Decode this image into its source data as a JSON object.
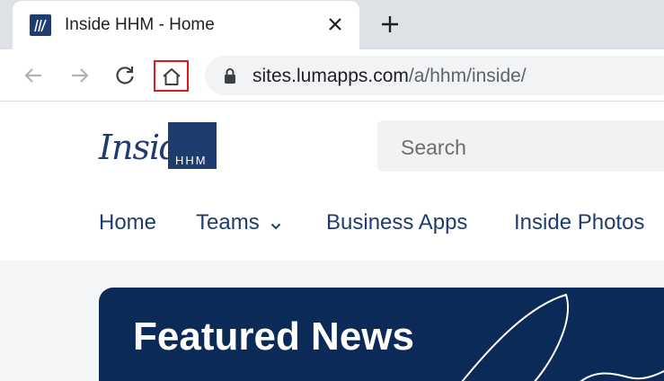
{
  "browser": {
    "tab": {
      "title": "Inside HHM - Home",
      "favicon": "site-favicon-icon"
    },
    "url": {
      "host": "sites.lumapps.com",
      "path": "/a/hhm/inside/"
    }
  },
  "site": {
    "logo": {
      "primary": "Inside",
      "secondary": "HHM"
    },
    "search": {
      "placeholder": "Search"
    },
    "nav": [
      {
        "label": "Home"
      },
      {
        "label": "Teams",
        "has_dropdown": true
      },
      {
        "label": "Business Apps"
      },
      {
        "label": "Inside Photos"
      }
    ],
    "featured": {
      "title": "Featured News"
    }
  },
  "colors": {
    "brand": "#1f3c6e",
    "featured_bg": "#0c2a57",
    "highlight": "#e0191e"
  }
}
